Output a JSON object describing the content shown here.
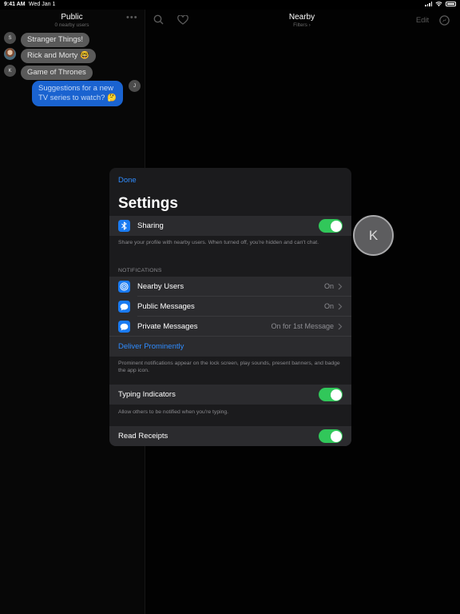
{
  "status_bar": {
    "time": "9:41 AM",
    "date": "Wed Jan 1"
  },
  "public_pane": {
    "title": "Public",
    "subtitle": "0 nearby users",
    "messages": [
      {
        "avatar": "S",
        "text": "Stranger Things!"
      },
      {
        "avatar": "",
        "text": "Rick and Morty 🤓"
      },
      {
        "avatar": "K",
        "text": "Game of Thrones"
      }
    ],
    "my_message": {
      "avatar": "J",
      "text": "Suggestions for a new TV series to watch? 🤔"
    }
  },
  "nearby_pane": {
    "title": "Nearby",
    "subtitle": "Filters ",
    "edit_label": "Edit"
  },
  "settings": {
    "done_label": "Done",
    "title": "Settings",
    "sharing": {
      "label": "Sharing",
      "on": true,
      "footer": "Share your profile with nearby users. When turned off, you're hidden and can't chat."
    },
    "notifications": {
      "header": "NOTIFICATIONS",
      "rows": [
        {
          "icon": "target-icon",
          "label": "Nearby Users",
          "value": "On"
        },
        {
          "icon": "chat-bubble-icon",
          "label": "Public Messages",
          "value": "On"
        },
        {
          "icon": "chat-bubble-icon",
          "label": "Private Messages",
          "value": "On for 1st Message"
        }
      ],
      "deliver_label": "Deliver Prominently",
      "footer": "Prominent notifications appear on the lock screen, play sounds, present banners, and badge the app icon."
    },
    "typing_indicators": {
      "label": "Typing Indicators",
      "on": true,
      "footer": "Allow others to be notified when you're typing."
    },
    "read_receipts": {
      "label": "Read Receipts",
      "on": true
    }
  },
  "floating_avatar": {
    "initial": "K"
  },
  "colors": {
    "accent": "#2f8cff",
    "toggle_on": "#31c75a",
    "bubble_mine": "#1a63d0"
  }
}
